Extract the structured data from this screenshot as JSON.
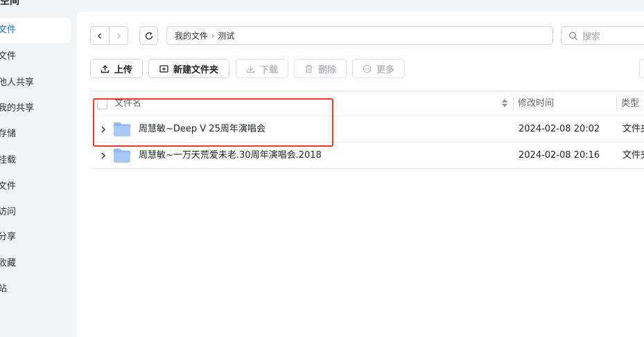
{
  "app": {
    "title_stub": "空间"
  },
  "sidebar": {
    "items": [
      {
        "label": "文件"
      },
      {
        "label": "文件"
      },
      {
        "label": "他人共享"
      },
      {
        "label": "我的共享"
      },
      {
        "label": "存储"
      },
      {
        "label": "挂载"
      },
      {
        "label": "文件"
      },
      {
        "label": "访问"
      },
      {
        "label": "分享"
      },
      {
        "label": "收藏"
      },
      {
        "label": "站"
      }
    ]
  },
  "path": {
    "root": "我的文件",
    "current": "测试"
  },
  "search": {
    "placeholder": "搜索"
  },
  "toolbar": {
    "upload": "上传",
    "new_folder": "新建文件夹",
    "download": "下载",
    "delete": "删除",
    "more": "更多"
  },
  "table": {
    "columns": {
      "name": "文件名",
      "modified": "修改时间",
      "type": "类型"
    },
    "rows": [
      {
        "name": "周慧敏~Deep V 25周年演唱会",
        "modified": "2024-02-08 20:02",
        "type": "文件夹"
      },
      {
        "name": "周慧敏~一万天荒爱未老.30周年演唱会.2018",
        "modified": "2024-02-08 20:16",
        "type": "文件夹"
      }
    ]
  },
  "colors": {
    "accent": "#1e6fd9",
    "folder": "#8fb8f5",
    "highlight": "#e8372c"
  }
}
